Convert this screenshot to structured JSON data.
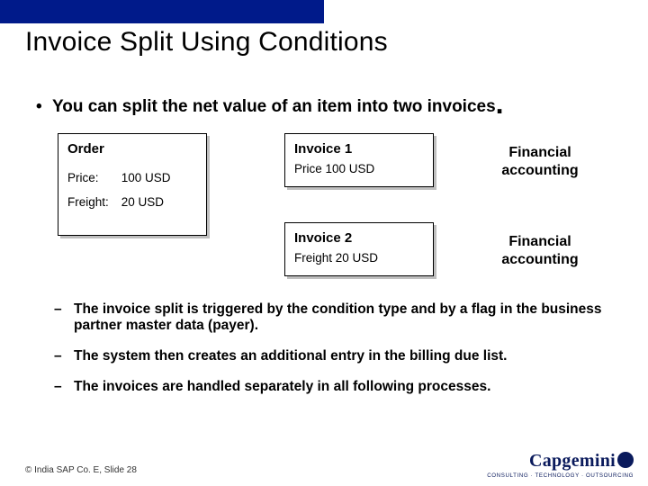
{
  "title": "Invoice Split Using Conditions",
  "main_bullet": {
    "marker": "•",
    "text": "You can split the net value of an item into two invoices",
    "trailing": "."
  },
  "boxes": {
    "order": {
      "header": "Order",
      "rows": [
        {
          "key": "Price:",
          "val": "100 USD"
        },
        {
          "key": "Freight:",
          "val": "20 USD"
        }
      ]
    },
    "invoice1": {
      "header": "Invoice 1",
      "line": "Price 100 USD"
    },
    "invoice2": {
      "header": "Invoice 2",
      "line": "Freight 20 USD"
    }
  },
  "fa_labels": {
    "a": "Financial accounting",
    "b": "Financial accounting"
  },
  "sub_bullets": [
    "The invoice split is triggered by the condition type and by a flag in the business partner master data (payer).",
    "The system then creates an additional entry in the billing due list.",
    "The invoices are handled separately in all following processes."
  ],
  "footer": "© India SAP Co. E, Slide 28",
  "logo": {
    "name": "Capgemini",
    "tagline": "CONSULTING · TECHNOLOGY · OUTSOURCING"
  }
}
